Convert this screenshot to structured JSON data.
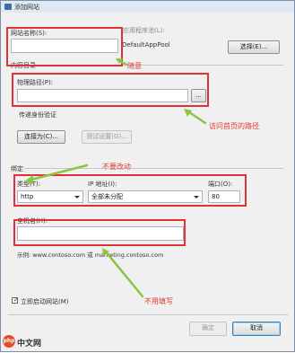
{
  "window": {
    "title": "添加网站"
  },
  "site": {
    "name_label": "网站名称(S):",
    "name_value": "",
    "pool_label": "应用程序池(L):",
    "pool_value": "DefaultAppPool",
    "select_button": "选择(E)..."
  },
  "content": {
    "section_label": "内容目录",
    "path_label": "物理路径(P):",
    "path_value": "",
    "browse_button": "...",
    "passthrough_label": "传递身份验证",
    "connect_as_button": "连接为(C)...",
    "test_settings_button": "测试设置(G)..."
  },
  "binding": {
    "section_label": "绑定",
    "type_label": "类型(T):",
    "type_value": "http",
    "ip_label": "IP 地址(I):",
    "ip_value": "全部未分配",
    "port_label": "端口(O):",
    "port_value": "80",
    "host_label": "主机名(H):",
    "host_value": "",
    "example_text": "示例: www.contoso.com 或 marketing.contoso.com"
  },
  "footer": {
    "start_label": "立即启动网站(M)",
    "start_checked": true,
    "ok_button": "确定",
    "cancel_button": "取消"
  },
  "annotations": {
    "site_name_note": "随意",
    "path_note": "访问首页的路径",
    "binding_note": "不要改动",
    "host_note": "不用填写"
  },
  "watermark": {
    "badge": "php",
    "text": "中文网"
  },
  "colors": {
    "annotation_red": "#e0303a",
    "arrow_green": "#8cc63f"
  }
}
